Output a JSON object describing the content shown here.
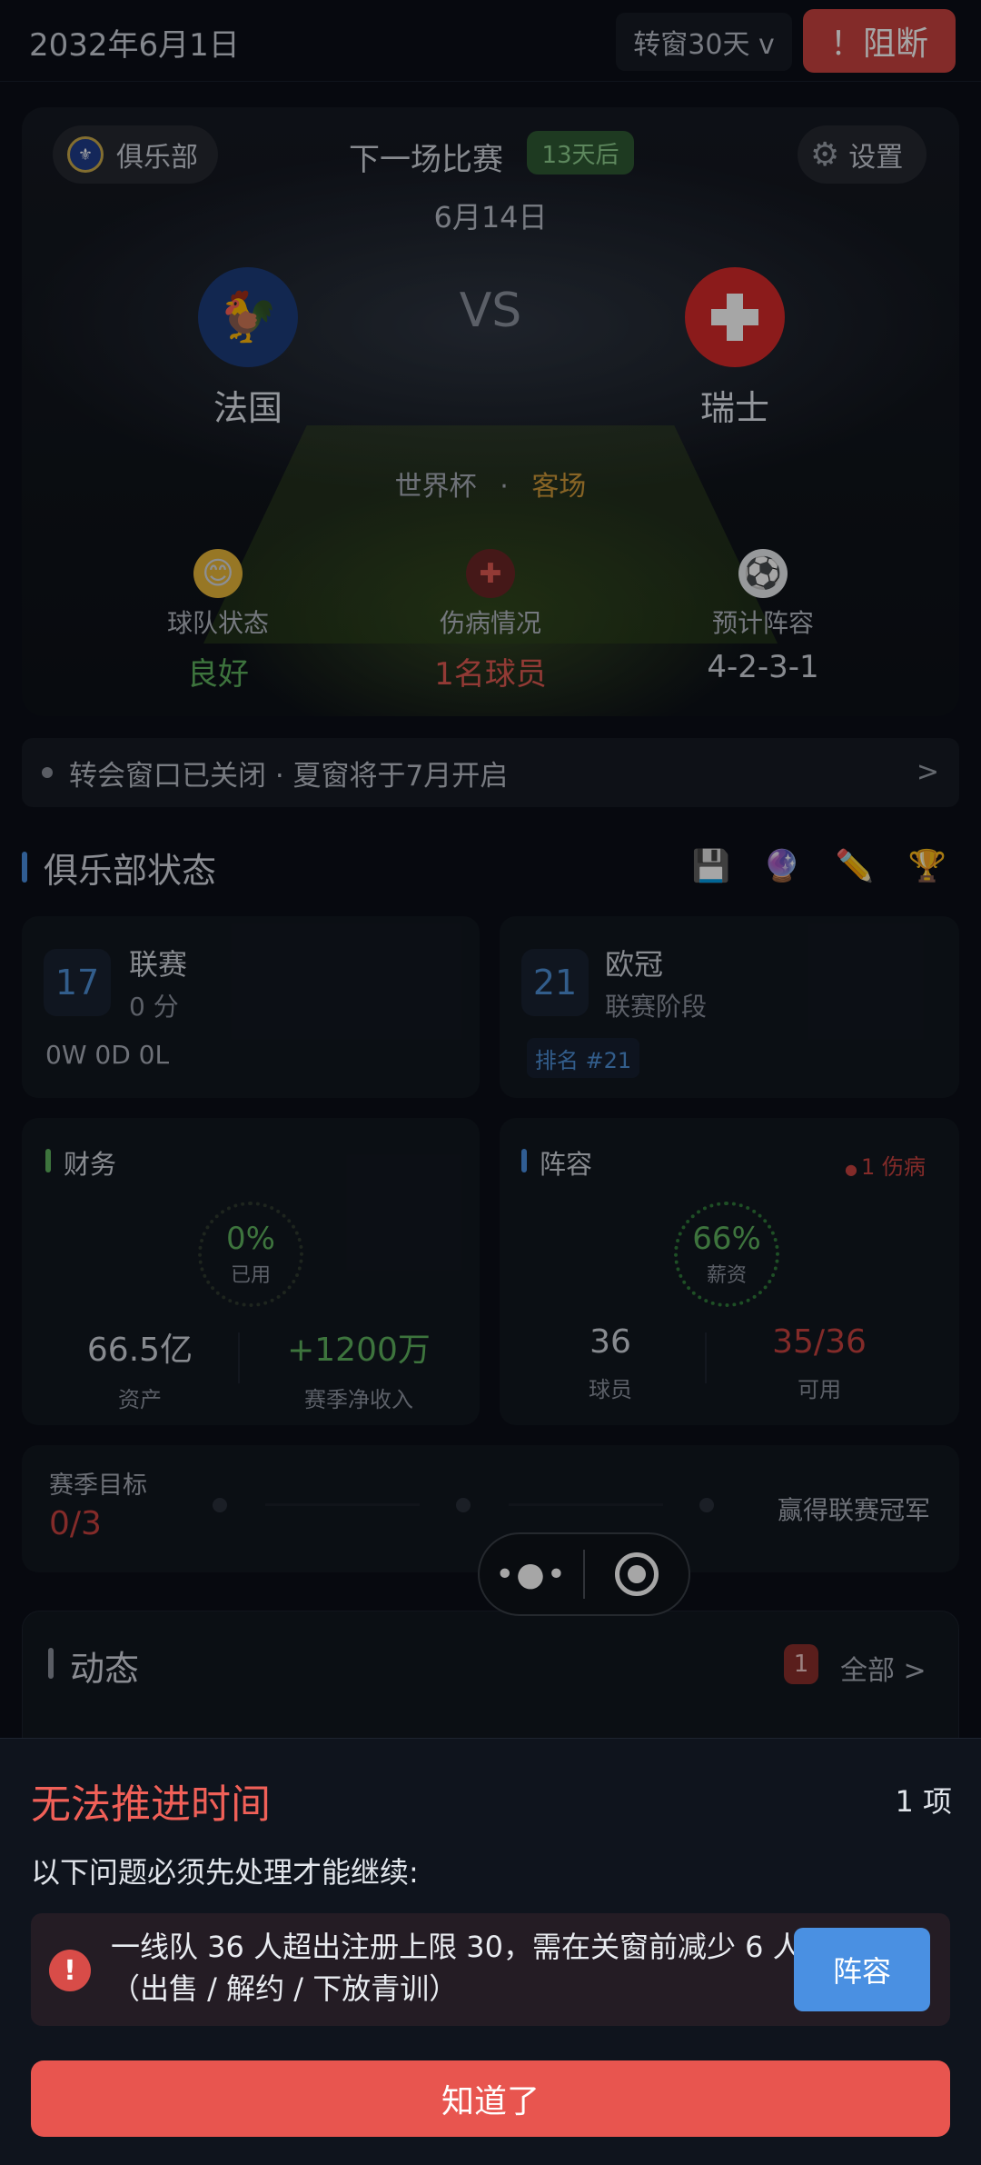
{
  "header": {
    "date": "2032年6月1日",
    "window_btn": "转窗30天 v",
    "block_btn": "！阻断"
  },
  "match": {
    "club_label": "俱乐部",
    "settings_label": "设置",
    "next_label": "下一场比赛",
    "countdown": "13天后",
    "date": "6月14日",
    "home_team": "法国",
    "away_team": "瑞士",
    "vs": "VS",
    "competition": "世界杯",
    "separator": "·",
    "venue": "客场",
    "stats": [
      {
        "label": "球队状态",
        "value": "良好",
        "icon": "smile-emoji-icon",
        "color": "#5fb25f"
      },
      {
        "label": "伤病情况",
        "value": "1名球员",
        "icon": "medical-cross-icon",
        "color": "#e05a52"
      },
      {
        "label": "预计阵容",
        "value": "4-2-3-1",
        "icon": "soccer-ball-icon",
        "color": "#d0d4dc"
      }
    ]
  },
  "notice": {
    "text": "转会窗口已关闭 · 夏窗将于7月开启",
    "chevron": ">"
  },
  "club_status": {
    "title": "俱乐部状态",
    "icons": [
      "save-icon",
      "crystal-ball-icon",
      "pencil-icon",
      "trophy-icon"
    ],
    "league": {
      "rank": "17",
      "name": "联赛",
      "points": "0 分",
      "record": "0W 0D 0L"
    },
    "ucl": {
      "rank": "21",
      "name": "欧冠",
      "stage": "联赛阶段",
      "tag": "排名 #21"
    },
    "finance": {
      "title": "财务",
      "pct": "0%",
      "pct_label": "已用",
      "assets": "66.5亿",
      "assets_label": "资产",
      "income": "+1200万",
      "income_label": "赛季净收入"
    },
    "squad": {
      "title": "阵容",
      "injury_tag": "1 伤病",
      "pct": "66%",
      "pct_label": "薪资",
      "players": "36",
      "players_label": "球员",
      "available": "35/36",
      "available_label": "可用"
    },
    "goals": {
      "label": "赛季目标",
      "progress": "0/3",
      "target": "赢得联赛冠军"
    }
  },
  "dynamics": {
    "title": "动态",
    "count": "1",
    "all_label": "全部 >"
  },
  "sheet": {
    "title": "无法推进时间",
    "count": "1 项",
    "desc": "以下问题必须先处理才能继续:",
    "issue_icon": "!",
    "issue_text": "一线队 36 人超出注册上限 30，需在关窗前减少 6 人（出售 / 解约 / 下放青训）",
    "issue_btn": "阵容",
    "ok_btn": "知道了"
  },
  "colors": {
    "accent_blue": "#4a90e2",
    "danger": "#e8554f",
    "good": "#5fb25f",
    "away_gold": "#d19a3a"
  }
}
